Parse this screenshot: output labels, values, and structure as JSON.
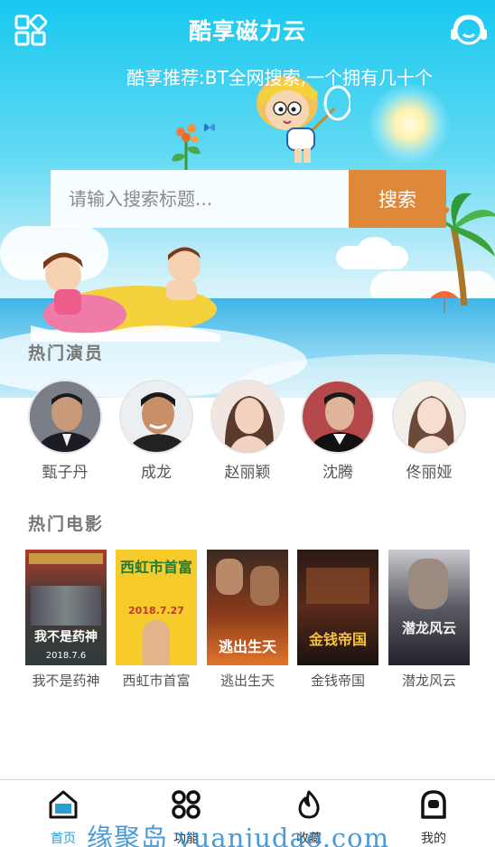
{
  "header": {
    "title": "酷享磁力云",
    "grid_icon": "grid-apps-icon",
    "support_icon": "headset-support-icon"
  },
  "marquee": {
    "text": "酷享推荐:BT全网搜索,一个拥有几十个"
  },
  "search": {
    "placeholder": "请输入搜索标题...",
    "button_label": "搜索",
    "button_color": "#e0883a"
  },
  "actors_section": {
    "title": "热门演员",
    "items": [
      {
        "name": "甄子丹"
      },
      {
        "name": "成龙"
      },
      {
        "name": "赵丽颖"
      },
      {
        "name": "沈腾"
      },
      {
        "name": "佟丽娅"
      }
    ]
  },
  "movies_section": {
    "title": "热门电影",
    "items": [
      {
        "name": "我不是药神",
        "poster_text": "我不是药神",
        "poster_date": "2018.7.6"
      },
      {
        "name": "西虹市首富",
        "poster_text": "西虹市首富",
        "poster_date": "2018.7.27"
      },
      {
        "name": "逃出生天",
        "poster_text": "逃出生天",
        "poster_date": ""
      },
      {
        "name": "金钱帝国",
        "poster_text": "金钱帝国",
        "poster_date": ""
      },
      {
        "name": "潜龙风云",
        "poster_text": "潜龙风云",
        "poster_date": ""
      }
    ]
  },
  "tabbar": {
    "active_color": "#2a9fd6",
    "items": [
      {
        "label": "首页",
        "icon": "home-icon"
      },
      {
        "label": "功能",
        "icon": "apps-icon"
      },
      {
        "label": "收藏",
        "icon": "flame-icon"
      },
      {
        "label": "我的",
        "icon": "user-icon"
      }
    ]
  },
  "watermark": {
    "text": "缘聚岛 yuanjudao.com"
  }
}
